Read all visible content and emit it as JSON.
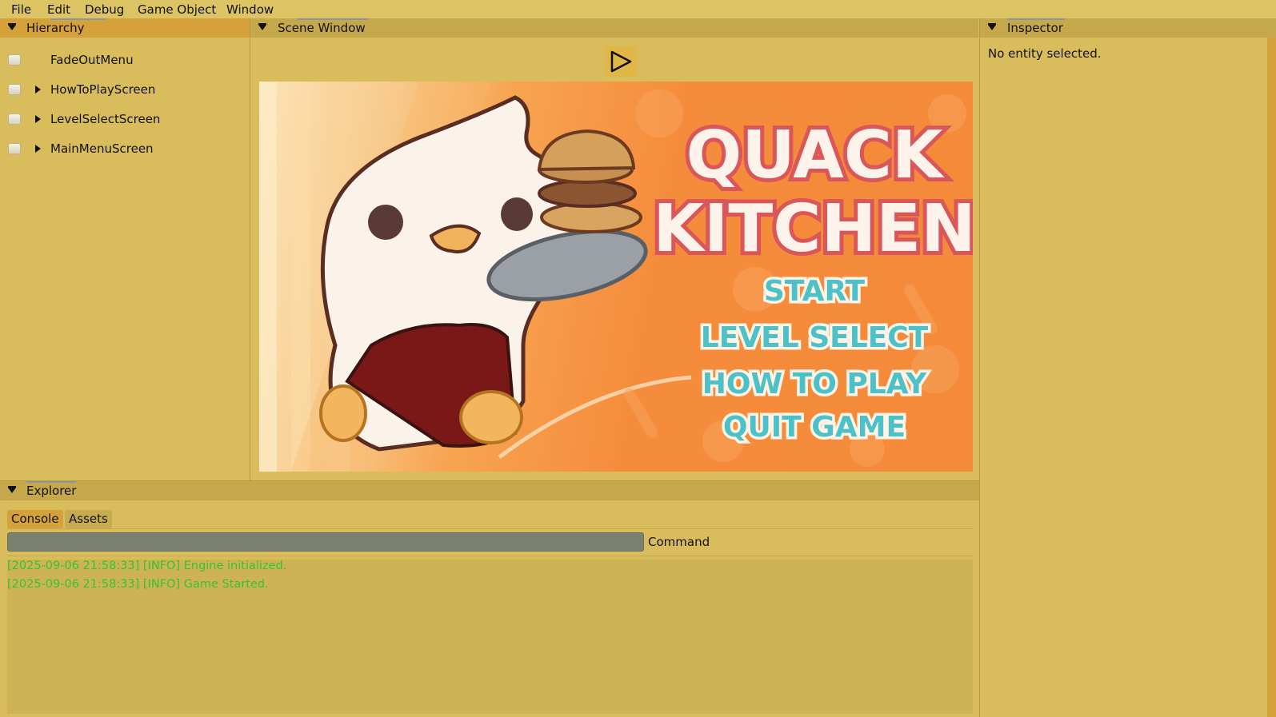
{
  "menu": [
    "File",
    "Edit",
    "Debug",
    "Game Object",
    "Window"
  ],
  "hierarchy": {
    "title": "Hierarchy",
    "items": [
      {
        "label": "FadeOutMenu",
        "expandable": false
      },
      {
        "label": "HowToPlayScreen",
        "expandable": true
      },
      {
        "label": "LevelSelectScreen",
        "expandable": true
      },
      {
        "label": "MainMenuScreen",
        "expandable": true
      }
    ]
  },
  "scene": {
    "title": "Scene Window",
    "play_icon": "play-icon",
    "game": {
      "title_line1": "QUACK",
      "title_line2": "KITCHEN",
      "buttons": [
        "START",
        "LEVEL SELECT",
        "HOW TO PLAY",
        "QUIT GAME"
      ]
    }
  },
  "inspector": {
    "title": "Inspector",
    "empty_text": "No entity selected."
  },
  "explorer": {
    "title": "Explorer",
    "tabs": [
      "Console",
      "Assets"
    ],
    "active_tab": "Console",
    "command_label": "Command",
    "command_value": "",
    "logs": [
      "[2025-09-06 21:58:33] [INFO] Engine initialized.",
      "[2025-09-06 21:58:33] [INFO] Game Started."
    ]
  },
  "colors": {
    "background": "#d9bd5c",
    "header": "#c4a84b",
    "header_active": "#d4a13a",
    "log_text": "#35c42c",
    "game_title": "#fdf3ea",
    "game_title_outline": "#d9565a",
    "game_buttons": "#4cc2c8"
  }
}
